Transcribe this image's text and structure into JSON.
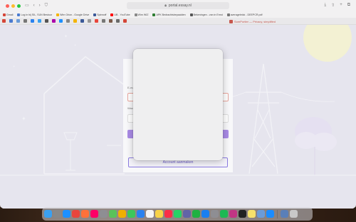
{
  "browser": {
    "address_text": "portal.essay.nl",
    "bookmarks": [
      {
        "label": "Gmail",
        "color": "#d44638"
      },
      {
        "label": "Log in bij SIL, SUN Bestuur",
        "color": "#4a7bd0"
      },
      {
        "label": "Wim Orion - Google Drive",
        "color": "#f4b400"
      },
      {
        "label": "Spinnoff",
        "color": "#3b5998"
      },
      {
        "label": "UB - YouTube",
        "color": "#ff0000"
      },
      {
        "label": "Wim WIZ",
        "color": "#888888"
      },
      {
        "label": "APK Bedrachtsbepaalden",
        "color": "#2e7d32"
      },
      {
        "label": "Bekeningen - van in Ernst",
        "color": "#555555"
      },
      {
        "label": "averagebrick - DEEPCR.pdf",
        "color": "#777777"
      }
    ],
    "active_tab_title": "SomPortier — Privacy, simplified"
  },
  "page": {
    "account_button_label": "Account aanmaken",
    "card_label_1": "E-mail",
    "card_label_2": "Wachtwoord"
  },
  "modal": {
    "visible": true
  },
  "dock": {
    "apps": [
      {
        "name": "finder-icon",
        "color": "#3aa0f0"
      },
      {
        "name": "launchpad-icon",
        "color": "#888888"
      },
      {
        "name": "safari-icon",
        "color": "#1e90ff"
      },
      {
        "name": "chrome-icon",
        "color": "#e8453c"
      },
      {
        "name": "firefox-icon",
        "color": "#ff7139"
      },
      {
        "name": "arc-icon",
        "color": "#f06"
      },
      {
        "name": "messages-icon",
        "color": "#8e8e93"
      },
      {
        "name": "maps-icon",
        "color": "#5ac25a"
      },
      {
        "name": "photos-icon",
        "color": "#f0b000"
      },
      {
        "name": "facetime-icon",
        "color": "#3cc85a"
      },
      {
        "name": "mail-icon",
        "color": "#2a82f0"
      },
      {
        "name": "calendar-icon",
        "color": "#f4f4f4"
      },
      {
        "name": "notes-icon",
        "color": "#f7d247"
      },
      {
        "name": "music-icon",
        "color": "#fa2d48"
      },
      {
        "name": "whatsapp-icon",
        "color": "#25d366"
      },
      {
        "name": "teams-icon",
        "color": "#6264a7"
      },
      {
        "name": "numbers-icon",
        "color": "#1fb141"
      },
      {
        "name": "keynote-icon",
        "color": "#1a7ff0"
      },
      {
        "name": "settings-icon",
        "color": "#8e8e93"
      },
      {
        "name": "spotify-icon",
        "color": "#1db954"
      },
      {
        "name": "instagram-icon",
        "color": "#c13584"
      },
      {
        "name": "terminal-icon",
        "color": "#222222"
      },
      {
        "name": "stickies-icon",
        "color": "#f5e16b"
      },
      {
        "name": "preview-icon",
        "color": "#6a9bd8"
      },
      {
        "name": "app-store-icon",
        "color": "#1a8cff"
      },
      {
        "name": "downloads-icon",
        "color": "#5a7fb8"
      },
      {
        "name": "trash-icon",
        "color": "#c8c8c8"
      }
    ]
  },
  "colors": {
    "page_bg": "#dedcea",
    "accent_purple": "#8a7adf",
    "field_border": "#e8a59c"
  }
}
